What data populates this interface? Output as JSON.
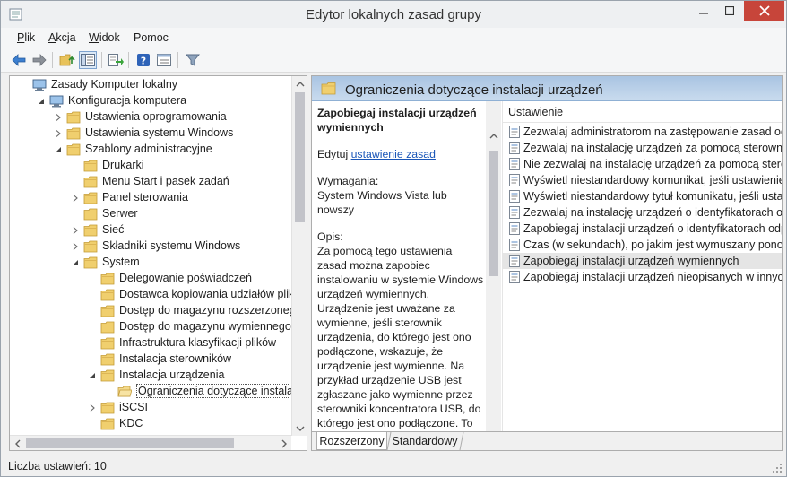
{
  "window": {
    "title": "Edytor lokalnych zasad grupy"
  },
  "menu": [
    {
      "key": "P",
      "rest": "lik"
    },
    {
      "key": "A",
      "rest": "kcja"
    },
    {
      "key": "W",
      "rest": "idok"
    },
    {
      "key": "P",
      "rest": "omoc",
      "prefix": ""
    }
  ],
  "toolbar": {
    "icons": [
      "back-arrow-icon",
      "forward-arrow-icon",
      "up-folder-icon",
      "show-hide-tree-icon",
      "export-list-icon",
      "help-icon",
      "properties-icon",
      "filter-icon"
    ]
  },
  "tree": {
    "items": [
      {
        "label": "Zasady Komputer lokalny",
        "level": 0,
        "exp": "",
        "icon": "computer"
      },
      {
        "label": "Konfiguracja komputera",
        "level": 1,
        "exp": "open",
        "icon": "computer"
      },
      {
        "label": "Ustawienia oprogramowania",
        "level": 2,
        "exp": "closed",
        "icon": "folder"
      },
      {
        "label": "Ustawienia systemu Windows",
        "level": 2,
        "exp": "closed",
        "icon": "folder"
      },
      {
        "label": "Szablony administracyjne",
        "level": 2,
        "exp": "open",
        "icon": "folder"
      },
      {
        "label": "Drukarki",
        "level": 3,
        "exp": "",
        "icon": "folder"
      },
      {
        "label": "Menu Start i pasek zadań",
        "level": 3,
        "exp": "",
        "icon": "folder"
      },
      {
        "label": "Panel sterowania",
        "level": 3,
        "exp": "closed",
        "icon": "folder"
      },
      {
        "label": "Serwer",
        "level": 3,
        "exp": "",
        "icon": "folder"
      },
      {
        "label": "Sieć",
        "level": 3,
        "exp": "closed",
        "icon": "folder"
      },
      {
        "label": "Składniki systemu Windows",
        "level": 3,
        "exp": "closed",
        "icon": "folder"
      },
      {
        "label": "System",
        "level": 3,
        "exp": "open",
        "icon": "folder"
      },
      {
        "label": "Delegowanie poświadczeń",
        "level": 4,
        "exp": "",
        "icon": "folder"
      },
      {
        "label": "Dostawca kopiowania udziałów plików w",
        "level": 4,
        "exp": "",
        "icon": "folder"
      },
      {
        "label": "Dostęp do magazynu rozszerzonego",
        "level": 4,
        "exp": "",
        "icon": "folder"
      },
      {
        "label": "Dostęp do magazynu wymiennego",
        "level": 4,
        "exp": "",
        "icon": "folder"
      },
      {
        "label": "Infrastruktura klasyfikacji plików",
        "level": 4,
        "exp": "",
        "icon": "folder"
      },
      {
        "label": "Instalacja sterowników",
        "level": 4,
        "exp": "",
        "icon": "folder"
      },
      {
        "label": "Instalacja urządzenia",
        "level": 4,
        "exp": "open",
        "icon": "folder"
      },
      {
        "label": "Ograniczenia dotyczące instalacji urz",
        "level": 5,
        "exp": "",
        "icon": "folder-open",
        "selected": true
      },
      {
        "label": "iSCSI",
        "level": 4,
        "exp": "closed",
        "icon": "folder"
      },
      {
        "label": "KDC",
        "level": 4,
        "exp": "",
        "icon": "folder"
      }
    ]
  },
  "right": {
    "header": "Ograniczenia dotyczące instalacji urządzeń",
    "desc": {
      "title": "Zapobiegaj instalacji urządzeń wymiennych",
      "edit_prefix": "Edytuj ",
      "edit_link": "ustawienie zasad ",
      "req_label": "Wymagania:",
      "req_value": "System Windows Vista lub nowszy",
      "opis_label": "Opis:",
      "opis_text": "Za pomocą tego ustawienia zasad można zapobiec instalowaniu w systemie Windows urządzeń wymiennych. Urządzenie jest uważane za wymienne, jeśli sterownik urządzenia, do którego jest ono podłączone, wskazuje, że urządzenie jest wymienne. Na przykład urządzenie USB jest zgłaszane jako wymienne przez sterowniki koncentratora USB, do którego jest ono podłączone. To ustawienie zasad ma pierwszeństwo przed każdym innym ustawieniem zasad, które"
    },
    "column_header": "Ustawienie",
    "settings": [
      "Zezwalaj administratorom na zastępowanie zasad ogra",
      "Zezwalaj na instalację urządzeń za pomocą sterowników",
      "Nie zezwalaj na instalację urządzeń za pomocą sterowni",
      "Wyświetl niestandardowy komunikat, jeśli ustawienie z",
      "Wyświetl niestandardowy tytuł komunikatu, jeśli ustaw",
      "Zezwalaj na instalację urządzeń o identyfikatorach odp",
      "Zapobiegaj instalacji urządzeń o identyfikatorach odpo",
      "Czas (w sekundach), po jakim jest wymuszany ponowny",
      "Zapobiegaj instalacji urządzeń wymiennych",
      "Zapobiegaj instalacji urządzeń nieopisanych w innych"
    ],
    "selected_setting": 8,
    "tabs": [
      "Rozszerzony",
      "Standardowy"
    ]
  },
  "status": {
    "text": "Liczba ustawień: 10"
  }
}
